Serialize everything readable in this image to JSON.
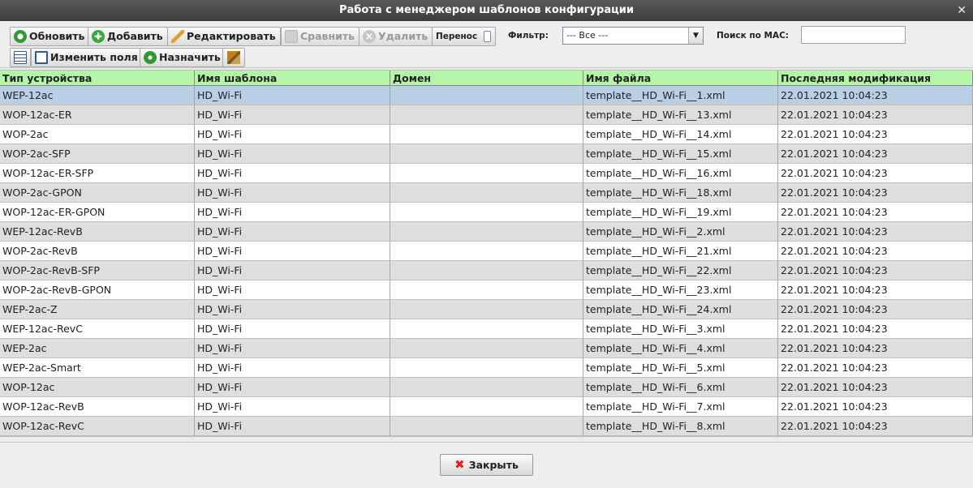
{
  "window": {
    "title": "Работа с менеджером шаблонов конфигурации"
  },
  "toolbar": {
    "refresh": "Обновить",
    "add": "Добавить",
    "edit": "Редактировать",
    "compare": "Сравнить",
    "delete": "Удалить",
    "transfer_label": "Перенос",
    "change_fields": "Изменить поля",
    "assign": "Назначить",
    "filter_label": "Фильтр:",
    "filter_value": "--- Все ---",
    "mac_search_label": "Поиск по MAC:",
    "mac_search_value": ""
  },
  "table": {
    "columns": [
      "Тип устройства",
      "Имя шаблона",
      "Домен",
      "Имя файла",
      "Последняя модификация"
    ],
    "rows": [
      [
        "WEP-12ac",
        "HD_Wi-Fi",
        "",
        "template__HD_Wi-Fi__1.xml",
        "22.01.2021 10:04:23"
      ],
      [
        "WOP-12ac-ER",
        "HD_Wi-Fi",
        "",
        "template__HD_Wi-Fi__13.xml",
        "22.01.2021 10:04:23"
      ],
      [
        "WOP-2ac",
        "HD_Wi-Fi",
        "",
        "template__HD_Wi-Fi__14.xml",
        "22.01.2021 10:04:23"
      ],
      [
        "WOP-2ac-SFP",
        "HD_Wi-Fi",
        "",
        "template__HD_Wi-Fi__15.xml",
        "22.01.2021 10:04:23"
      ],
      [
        "WOP-12ac-ER-SFP",
        "HD_Wi-Fi",
        "",
        "template__HD_Wi-Fi__16.xml",
        "22.01.2021 10:04:23"
      ],
      [
        "WOP-2ac-GPON",
        "HD_Wi-Fi",
        "",
        "template__HD_Wi-Fi__18.xml",
        "22.01.2021 10:04:23"
      ],
      [
        "WOP-12ac-ER-GPON",
        "HD_Wi-Fi",
        "",
        "template__HD_Wi-Fi__19.xml",
        "22.01.2021 10:04:23"
      ],
      [
        "WEP-12ac-RevB",
        "HD_Wi-Fi",
        "",
        "template__HD_Wi-Fi__2.xml",
        "22.01.2021 10:04:23"
      ],
      [
        "WOP-2ac-RevB",
        "HD_Wi-Fi",
        "",
        "template__HD_Wi-Fi__21.xml",
        "22.01.2021 10:04:23"
      ],
      [
        "WOP-2ac-RevB-SFP",
        "HD_Wi-Fi",
        "",
        "template__HD_Wi-Fi__22.xml",
        "22.01.2021 10:04:23"
      ],
      [
        "WOP-2ac-RevB-GPON",
        "HD_Wi-Fi",
        "",
        "template__HD_Wi-Fi__23.xml",
        "22.01.2021 10:04:23"
      ],
      [
        "WEP-2ac-Z",
        "HD_Wi-Fi",
        "",
        "template__HD_Wi-Fi__24.xml",
        "22.01.2021 10:04:23"
      ],
      [
        "WEP-12ac-RevC",
        "HD_Wi-Fi",
        "",
        "template__HD_Wi-Fi__3.xml",
        "22.01.2021 10:04:23"
      ],
      [
        "WEP-2ac",
        "HD_Wi-Fi",
        "",
        "template__HD_Wi-Fi__4.xml",
        "22.01.2021 10:04:23"
      ],
      [
        "WEP-2ac-Smart",
        "HD_Wi-Fi",
        "",
        "template__HD_Wi-Fi__5.xml",
        "22.01.2021 10:04:23"
      ],
      [
        "WOP-12ac",
        "HD_Wi-Fi",
        "",
        "template__HD_Wi-Fi__6.xml",
        "22.01.2021 10:04:23"
      ],
      [
        "WOP-12ac-RevB",
        "HD_Wi-Fi",
        "",
        "template__HD_Wi-Fi__7.xml",
        "22.01.2021 10:04:23"
      ],
      [
        "WOP-12ac-RevC",
        "HD_Wi-Fi",
        "",
        "template__HD_Wi-Fi__8.xml",
        "22.01.2021 10:04:23"
      ]
    ]
  },
  "footer": {
    "close": "Закрыть"
  },
  "colors": {
    "header_bg": "#b5f5a8",
    "selected_row": "#b8cfe6",
    "alt_row": "#dedede"
  }
}
